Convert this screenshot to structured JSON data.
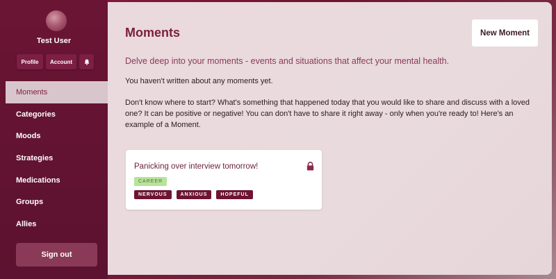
{
  "user": {
    "name": "Test User"
  },
  "sidebar": {
    "buttons": {
      "profile": "Profile",
      "account": "Account"
    },
    "nav": [
      {
        "label": "Moments",
        "active": true
      },
      {
        "label": "Categories"
      },
      {
        "label": "Moods"
      },
      {
        "label": "Strategies"
      },
      {
        "label": "Medications"
      },
      {
        "label": "Groups"
      },
      {
        "label": "Allies"
      }
    ],
    "signout_label": "Sign out"
  },
  "main": {
    "title": "Moments",
    "new_button": "New Moment",
    "subtitle": "Delve deep into your moments - events and situations that affect your mental health.",
    "empty_text": "You haven't written about any moments yet.",
    "prompt_text": "Don't know where to start? What's something that happened today that you would like to share and discuss with a loved one? It can be positive or negative! You can don't have to share it right away - only when you're ready to! Here's an example of a Moment.",
    "example": {
      "title": "Panicking over interview tomorrow!",
      "category": "CAREER",
      "moods": [
        "NERVOUS",
        "ANXIOUS",
        "HOPEFUL"
      ]
    }
  },
  "colors": {
    "accent": "#7a1f3d",
    "sidebar_bg": "#5c1230",
    "category_tag": "#b7e39a",
    "mood_tag": "#6e1432"
  },
  "icons": {
    "bell": "bell-icon",
    "lock": "lock-icon"
  }
}
